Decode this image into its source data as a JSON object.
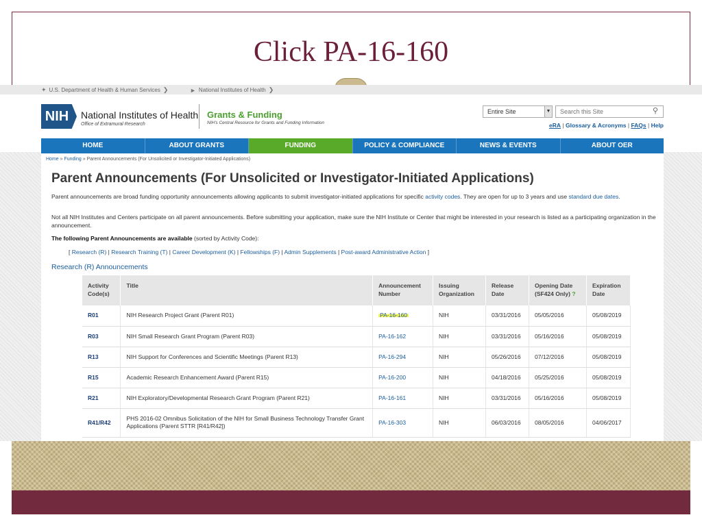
{
  "slide": {
    "title": "Click PA-16-160"
  },
  "hhs_bar": {
    "hhs": "U.S. Department of Health & Human Services",
    "nih": "National Institutes of Health"
  },
  "header": {
    "logo": "NIH",
    "org_name": "National Institutes of Health",
    "org_sub": "Office of Extramural Research",
    "gf_title": "Grants & Funding",
    "gf_sub": "NIH's Central Resource for Grants and Funding Information",
    "scope_select": "Entire Site",
    "search_placeholder": "Search this Site",
    "links": {
      "era": "eRA",
      "glossary": "Glossary & Acronyms",
      "faqs": "FAQs",
      "help": "Help"
    }
  },
  "nav": {
    "home": "HOME",
    "about_grants": "ABOUT GRANTS",
    "funding": "FUNDING",
    "policy": "POLICY & COMPLIANCE",
    "news": "NEWS & EVENTS",
    "about_oer": "ABOUT OER"
  },
  "breadcrumb": {
    "home": "Home",
    "funding": "Funding",
    "current": "Parent Announcements (For Unsolicited or Investigator-Initiated Applications)"
  },
  "page": {
    "title": "Parent Announcements (For Unsolicited or Investigator-Initiated Applications)",
    "p1_a": "Parent announcements are broad funding opportunity announcements allowing applicants to submit investigator-initiated applications for specific ",
    "p1_link1": "activity codes",
    "p1_b": ". They are open for up to 3 years and use ",
    "p1_link2": "standard due dates",
    "p1_c": ".",
    "p2": "Not all NIH Institutes and Centers participate on all parent announcements. Before submitting your application, make sure the NIH Institute or Center that might be interested in your research is listed as a participating organization in the announcement.",
    "p3_bold": "The following Parent Announcements are available",
    "p3_rest": " (sorted by Activity Code):",
    "section": "Research (R) Announcements"
  },
  "activity_links": {
    "research": "Research (R)",
    "training": "Research Training (T)",
    "career": "Career Development (K)",
    "fellowships": "Fellowships (F)",
    "admin": "Admin Supplements",
    "post_award": "Post-award Administrative Action"
  },
  "table": {
    "headers": {
      "code_1": "Activity",
      "code_2": "Code(s)",
      "title": "Title",
      "num_1": "Announcement",
      "num_2": "Number",
      "org_1": "Issuing",
      "org_2": "Organization",
      "rel_1": "Release",
      "rel_2": "Date",
      "open_1": "Opening Date",
      "open_2": "(SF424 Only)",
      "open_help": "?",
      "exp_1": "Expiration",
      "exp_2": "Date"
    },
    "rows": [
      {
        "code": "R01",
        "title": "NIH Research Project Grant (Parent R01)",
        "number": "PA-16-160",
        "org": "NIH",
        "release": "03/31/2016",
        "opening": "05/05/2016",
        "expiration": "05/08/2019"
      },
      {
        "code": "R03",
        "title": "NIH Small Research Grant Program (Parent R03)",
        "number": "PA-16-162",
        "org": "NIH",
        "release": "03/31/2016",
        "opening": "05/16/2016",
        "expiration": "05/08/2019"
      },
      {
        "code": "R13",
        "title": "NIH Support for Conferences and Scientific Meetings (Parent R13)",
        "number": "PA-16-294",
        "org": "NIH",
        "release": "05/26/2016",
        "opening": "07/12/2016",
        "expiration": "05/08/2019"
      },
      {
        "code": "R15",
        "title": "Academic Research Enhancement Award (Parent R15)",
        "number": "PA-16-200",
        "org": "NIH",
        "release": "04/18/2016",
        "opening": "05/25/2016",
        "expiration": "05/08/2019"
      },
      {
        "code": "R21",
        "title": "NIH Exploratory/Developmental Research Grant Program (Parent R21)",
        "number": "PA-16-161",
        "org": "NIH",
        "release": "03/31/2016",
        "opening": "05/16/2016",
        "expiration": "05/08/2019"
      },
      {
        "code": "R41/R42",
        "title": "PHS 2016-02 Omnibus Solicitation of the NIH for Small Business Technology Transfer Grant Applications (Parent STTR [R41/R42])",
        "number": "PA-16-303",
        "org": "NIH",
        "release": "06/03/2016",
        "opening": "08/05/2016",
        "expiration": "04/06/2017"
      }
    ]
  },
  "colors": {
    "slide_accent": "#722a3f",
    "nav_blue": "#1b75bc",
    "nav_active_green": "#5aaa2a",
    "link_blue": "#1a5d9e",
    "highlight_yellow": "#f7f35a"
  }
}
